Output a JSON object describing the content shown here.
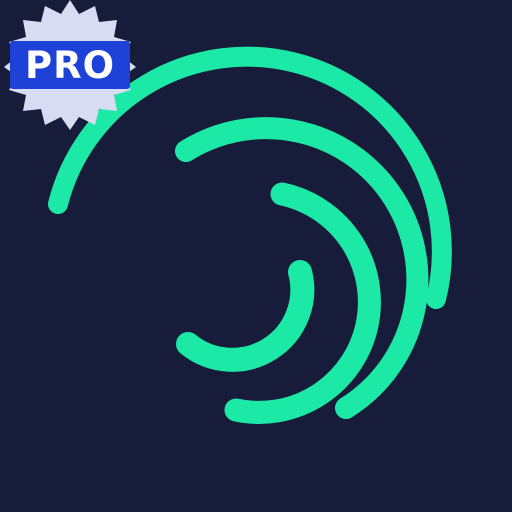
{
  "badge": {
    "label": "PRO"
  },
  "colors": {
    "background": "#171c3b",
    "accent": "#1de9a6",
    "badge_fill": "#1e41d8",
    "badge_star": "#d8dcf3",
    "badge_text": "#ffffff"
  },
  "icon": {
    "name": "swirl-arcs-logo-icon"
  }
}
